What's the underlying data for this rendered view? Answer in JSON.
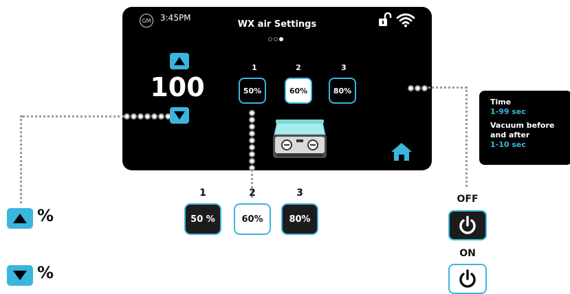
{
  "screen": {
    "badge": "GM",
    "time": "3:45PM",
    "title": "WX air Settings",
    "pager_count": 3,
    "pager_active": 3,
    "value": "100",
    "presets": [
      {
        "number": "1",
        "value": "50%",
        "selected": false
      },
      {
        "number": "2",
        "value": "60%",
        "selected": true
      },
      {
        "number": "3",
        "value": "80%",
        "selected": false
      }
    ],
    "accent_color": "#3ab6de",
    "icons": [
      "up-arrow-icon",
      "down-arrow-icon",
      "unlock-icon",
      "wifi-icon",
      "station-icon",
      "home-icon"
    ]
  },
  "info": {
    "time_label": "Time",
    "time_range": "1-99 sec",
    "vacuum_label_1": "Vacuum before",
    "vacuum_label_2": "and after",
    "vacuum_range": "1-10 sec"
  },
  "lower_presets": [
    {
      "number": "1",
      "value": "50 %",
      "selected": false
    },
    {
      "number": "2",
      "value": "60%",
      "selected": true
    },
    {
      "number": "3",
      "value": "80%",
      "selected": false
    }
  ],
  "legend": {
    "up_unit": "%",
    "down_unit": "%",
    "off_label": "OFF",
    "on_label": "ON"
  }
}
